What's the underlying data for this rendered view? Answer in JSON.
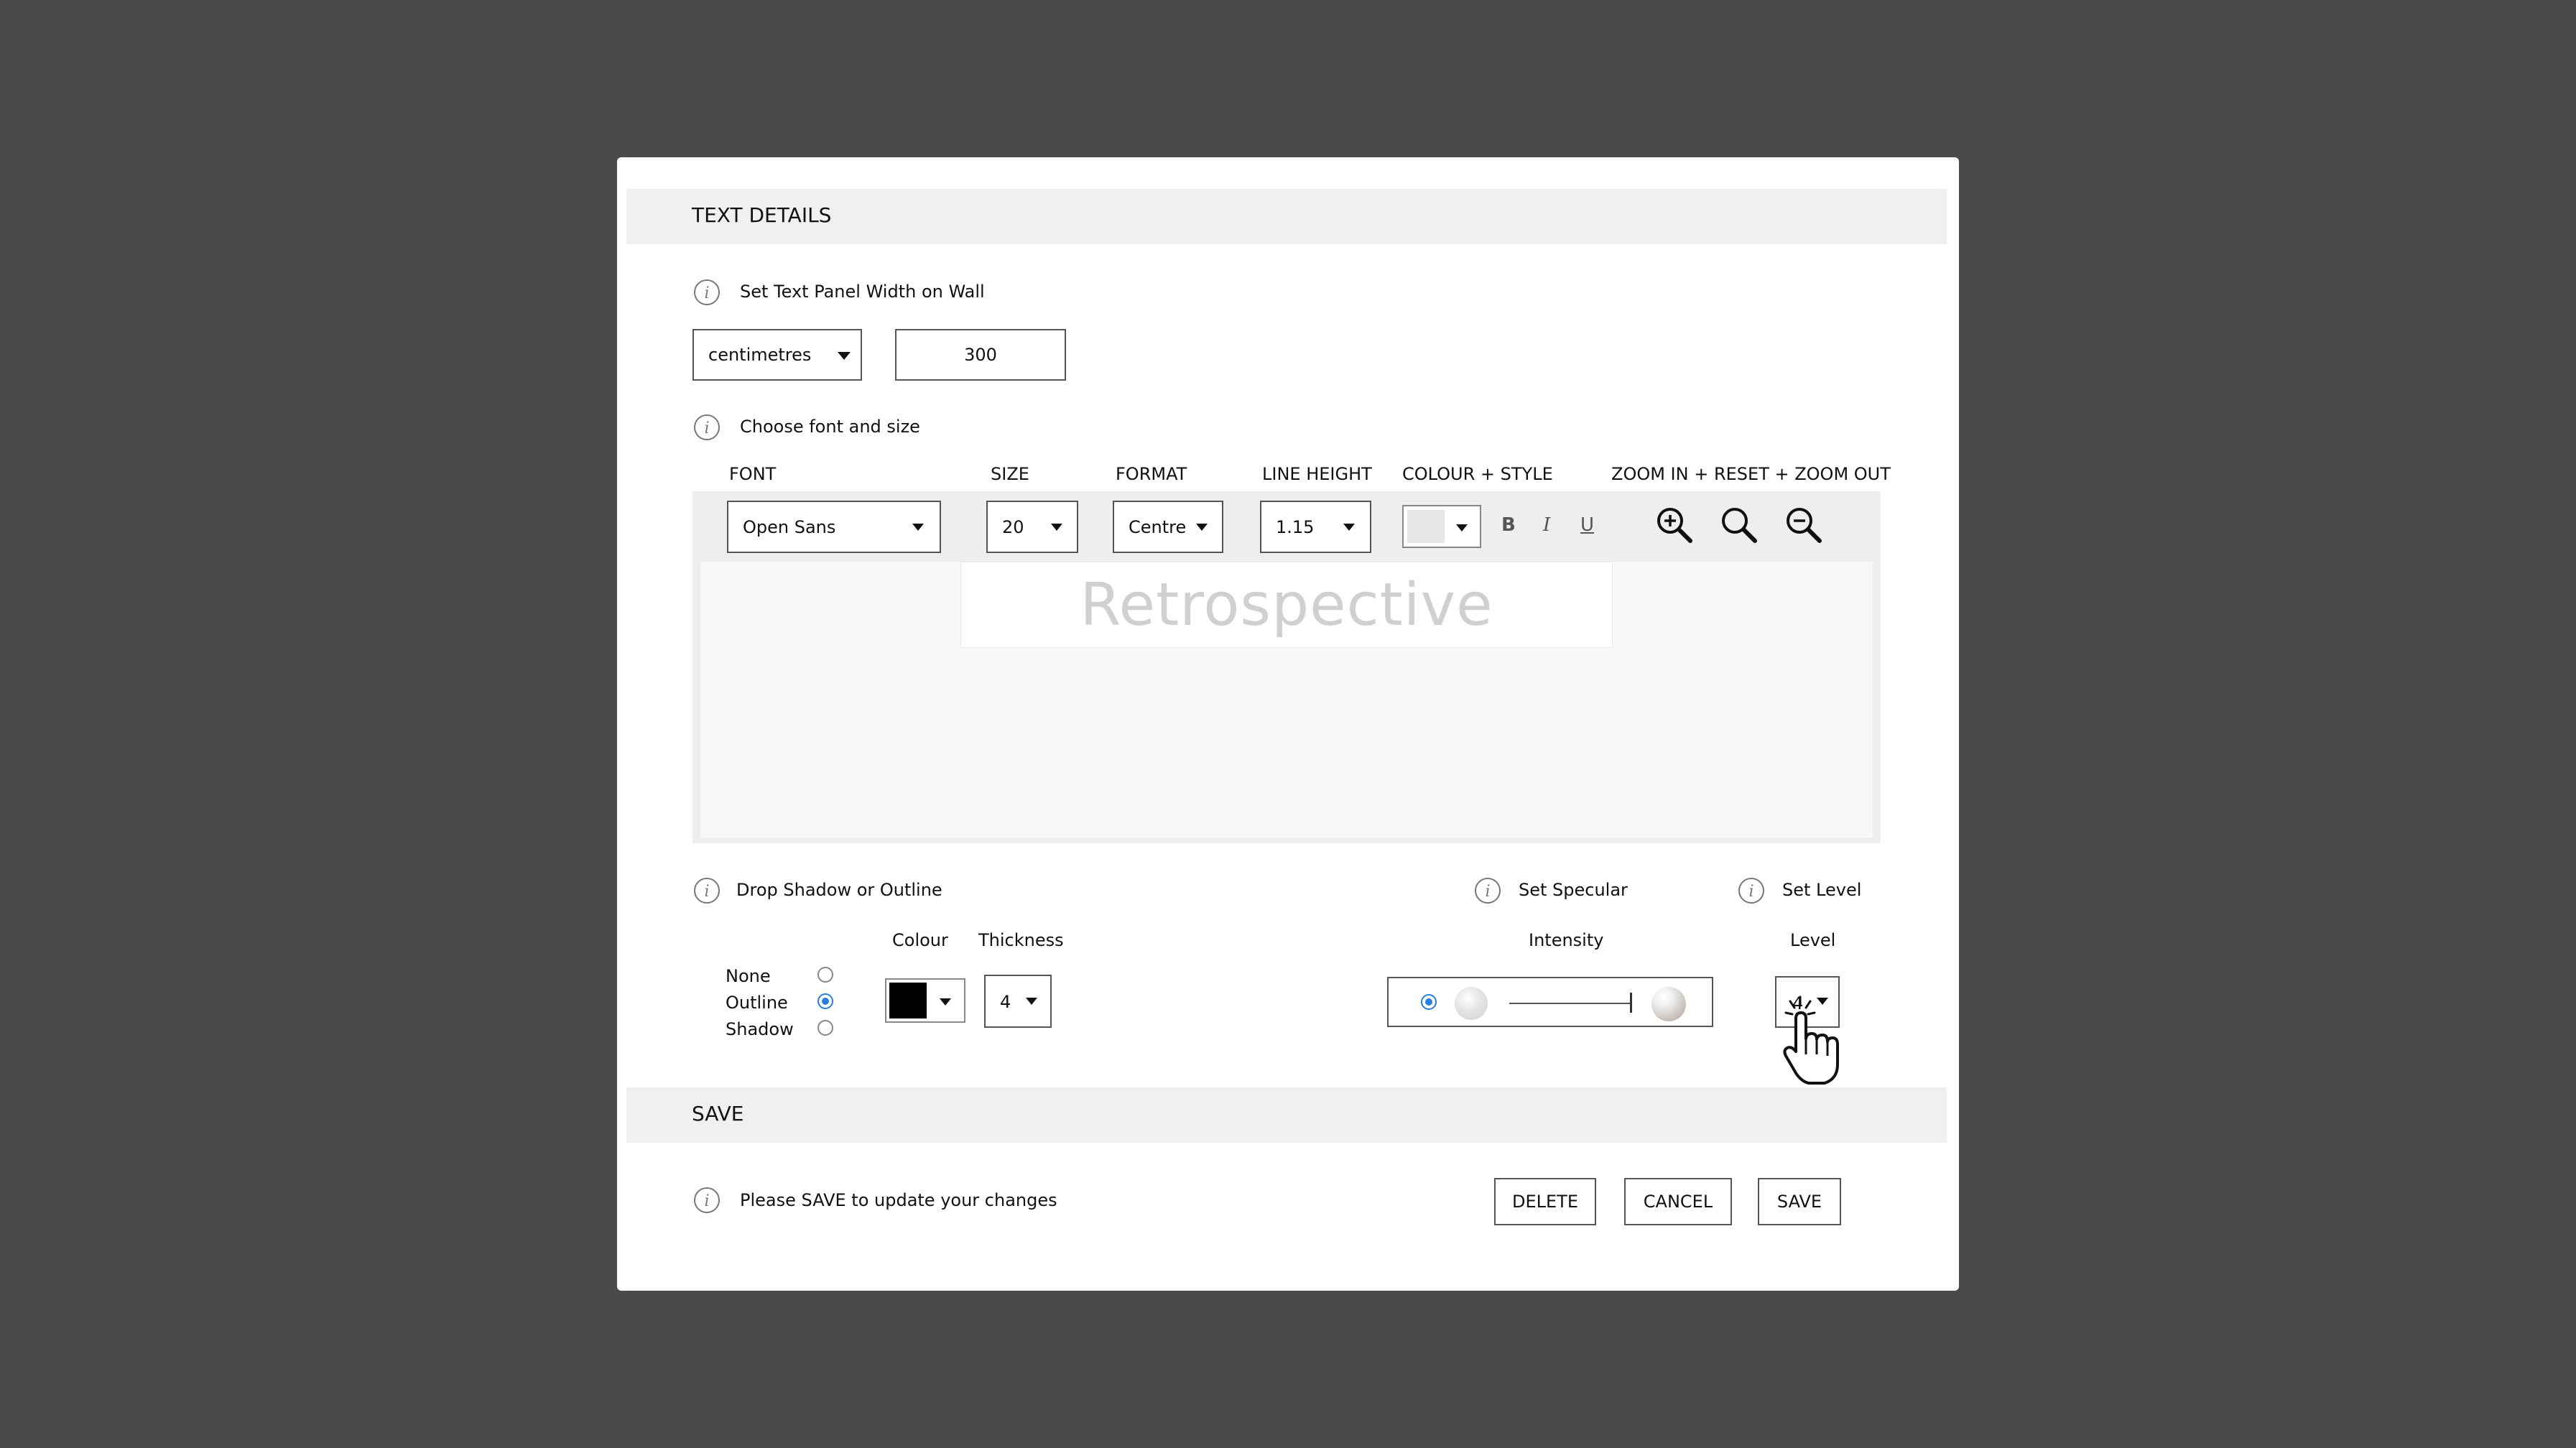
{
  "text_details": {
    "title": "TEXT DETAILS",
    "panel_width": {
      "label": "Set Text Panel Width on Wall",
      "unit": "centimetres",
      "value": "300"
    },
    "font_section": {
      "label": "Choose font and size",
      "headers": {
        "font": "FONT",
        "size": "SIZE",
        "format": "FORMAT",
        "line_height": "LINE HEIGHT",
        "colour_style": "COLOUR + STYLE",
        "zoom": "ZOOM IN + RESET + ZOOM OUT"
      },
      "font": "Open Sans",
      "size": "20",
      "format": "Centre",
      "line_height": "1.15",
      "style_buttons": {
        "bold": "B",
        "italic": "I",
        "underline": "U"
      },
      "preview_text": "Retrospective"
    },
    "shadow_outline": {
      "label": "Drop Shadow or Outline",
      "colour_header": "Colour",
      "thickness_header": "Thickness",
      "options": [
        "None",
        "Outline",
        "Shadow"
      ],
      "selected": "Outline",
      "colour": "#000000",
      "thickness": "4"
    },
    "specular": {
      "label": "Set Specular",
      "header": "Intensity"
    },
    "level": {
      "label": "Set Level",
      "header": "Level",
      "value": "4"
    }
  },
  "save_section": {
    "title": "SAVE",
    "message": "Please SAVE to update your changes",
    "buttons": {
      "delete": "DELETE",
      "cancel": "CANCEL",
      "save": "SAVE"
    }
  },
  "colors": {
    "backdrop": "#4a4a4a",
    "section_bar": "#f0f0f0",
    "radio_accent": "#2a7de1",
    "preview_text": "#d0d0d0"
  }
}
